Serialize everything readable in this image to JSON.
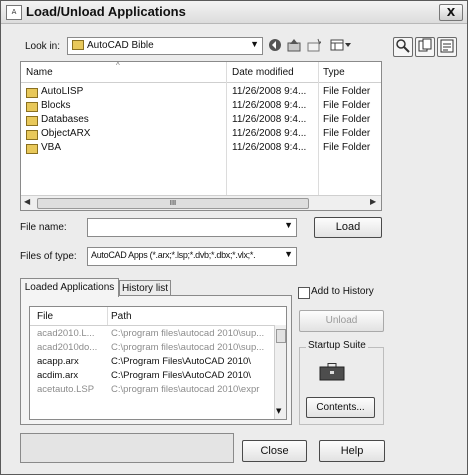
{
  "window": {
    "title": "Load/Unload Applications",
    "close_glyph": "X"
  },
  "lookin": {
    "label": "Look in:",
    "value": "AutoCAD Bible",
    "toolbar_icons": [
      "back-icon",
      "up-folder-icon",
      "new-folder-icon",
      "views-icon"
    ],
    "right_tools": [
      "find-icon",
      "copy-icon",
      "properties-icon"
    ]
  },
  "file_list": {
    "columns": [
      "Name",
      "Date modified",
      "Type"
    ],
    "rows": [
      {
        "name": "AutoLISP",
        "date": "11/26/2008 9:4...",
        "type": "File Folder"
      },
      {
        "name": "Blocks",
        "date": "11/26/2008 9:4...",
        "type": "File Folder"
      },
      {
        "name": "Databases",
        "date": "11/26/2008 9:4...",
        "type": "File Folder"
      },
      {
        "name": "ObjectARX",
        "date": "11/26/2008 9:4...",
        "type": "File Folder"
      },
      {
        "name": "VBA",
        "date": "11/26/2008 9:4...",
        "type": "File Folder"
      }
    ],
    "scroll_thumb_glyph": "III"
  },
  "file_name": {
    "label": "File name:",
    "value": ""
  },
  "files_of_type": {
    "label": "Files of type:",
    "value": "AutoCAD Apps (*.arx;*.lsp;*.dvb;*.dbx;*.vlx;*."
  },
  "buttons": {
    "load": "Load",
    "unload": "Unload",
    "contents": "Contents...",
    "close": "Close",
    "help": "Help"
  },
  "tabs": [
    {
      "label": "Loaded Applications",
      "active": true
    },
    {
      "label": "History list",
      "active": false
    }
  ],
  "loaded_list": {
    "columns": [
      "File",
      "Path"
    ],
    "rows": [
      {
        "file": "acad2010.L...",
        "path": "C:\\program files\\autocad 2010\\sup...",
        "dim": true
      },
      {
        "file": "acad2010do...",
        "path": "C:\\program files\\autocad 2010\\sup...",
        "dim": true
      },
      {
        "file": "acapp.arx",
        "path": "C:\\Program Files\\AutoCAD 2010\\",
        "dim": false
      },
      {
        "file": "acdim.arx",
        "path": "C:\\Program Files\\AutoCAD 2010\\",
        "dim": false
      },
      {
        "file": "acetauto.LSP",
        "path": "C:\\program files\\autocad 2010\\expr",
        "dim": true
      }
    ]
  },
  "add_to_history": {
    "label": "Add to History",
    "checked": false
  },
  "startup_suite": {
    "label": "Startup Suite",
    "icon": "briefcase-icon"
  }
}
